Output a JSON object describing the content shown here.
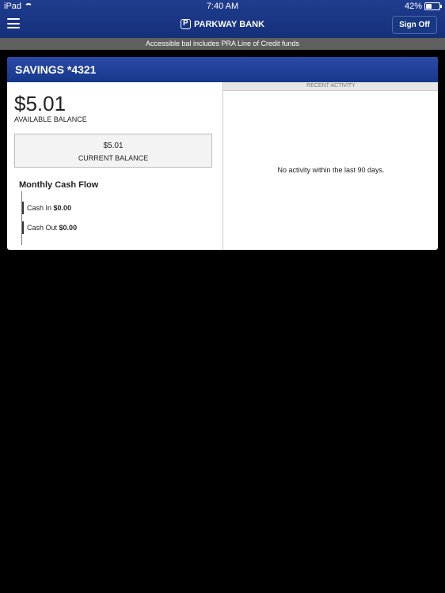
{
  "status_bar": {
    "device": "iPad",
    "time": "7:40 AM",
    "battery": "42%",
    "battery_level": 0.42
  },
  "header": {
    "brand": "PARKWAY BANK",
    "sign_off": "Sign Off"
  },
  "notice": "Accessible bal includes PRA Line of Credit funds",
  "account": {
    "title": "SAVINGS *4321",
    "available_balance": "$5.01",
    "available_label": "AVAILABLE BALANCE",
    "current_balance": "$5.01",
    "current_label": "CURRENT BALANCE"
  },
  "cash_flow": {
    "title": "Monthly Cash Flow",
    "cash_in_label": "Cash In",
    "cash_in_value": "$0.00",
    "cash_out_label": "Cash Out",
    "cash_out_value": "$0.00"
  },
  "recent_activity": {
    "header": "RECENT ACTIVITY",
    "empty_message": "No activity within the last 90 days."
  }
}
